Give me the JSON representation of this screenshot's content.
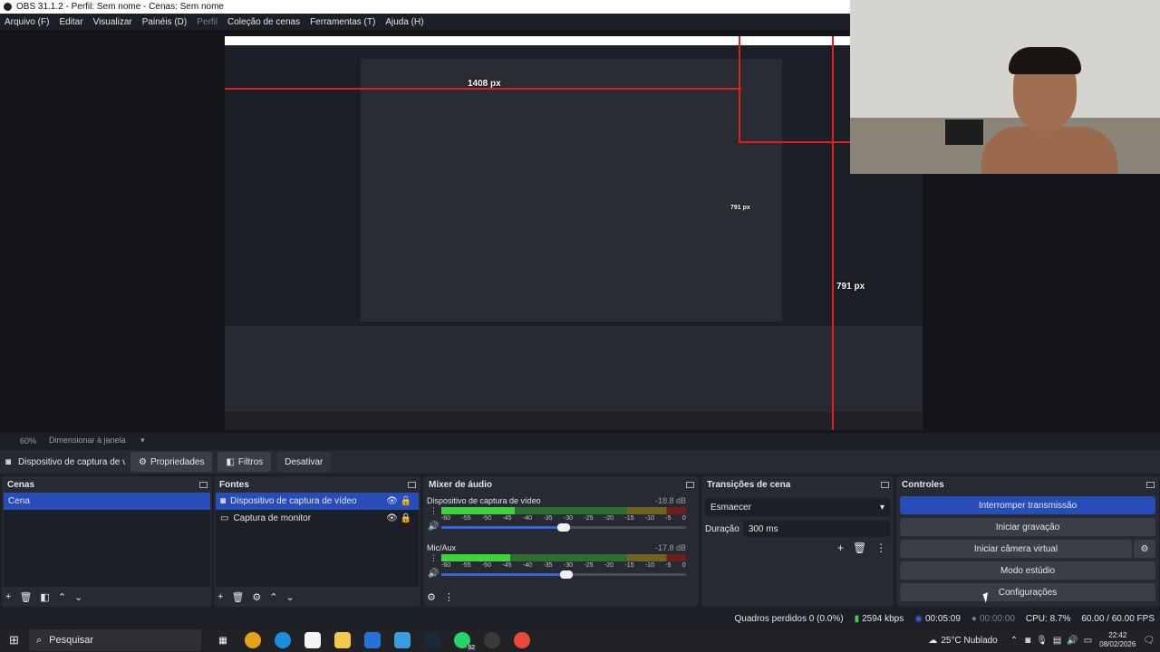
{
  "window": {
    "title": "OBS 31.1.2 - Perfil: Sem nome - Cenas: Sem nome"
  },
  "menu": [
    {
      "label": "Arquivo (F)",
      "dim": false
    },
    {
      "label": "Editar",
      "dim": false
    },
    {
      "label": "Visualizar",
      "dim": false
    },
    {
      "label": "Painéis (D)",
      "dim": false
    },
    {
      "label": "Perfil",
      "dim": true
    },
    {
      "label": "Coleção de cenas",
      "dim": false
    },
    {
      "label": "Ferramentas (T)",
      "dim": false
    },
    {
      "label": "Ajuda (H)",
      "dim": false
    }
  ],
  "preview": {
    "width_label": "1408 px",
    "height_label_top": "791 px",
    "height_label": "791 px",
    "zoom": "60%",
    "resize_label": "Dimensionar à janela"
  },
  "source_toolbar": {
    "source_name": "Dispositivo de captura de v",
    "properties": "Propriedades",
    "filters": "Filtros",
    "deactivate": "Desativar"
  },
  "scenes": {
    "title": "Cenas",
    "items": [
      "Cena"
    ]
  },
  "sources": {
    "title": "Fontes",
    "items": [
      {
        "label": "Dispositivo de captura de vídeo"
      },
      {
        "label": "Captura de monitor"
      }
    ]
  },
  "mixer": {
    "title": "Mixer de áudio",
    "scale": [
      "-60",
      "-55",
      "-50",
      "-45",
      "-40",
      "-35",
      "-30",
      "-25",
      "-20",
      "-15",
      "-10",
      "-5",
      "0"
    ],
    "channels": [
      {
        "name": "Dispositivo de captura de vídeo",
        "db": "-18.8 dB",
        "level": 0.3,
        "volume": 0.5
      },
      {
        "name": "Mic/Aux",
        "db": "-17.8 dB",
        "level": 0.28,
        "volume": 0.51
      }
    ]
  },
  "transitions": {
    "title": "Transições de cena",
    "selected": "Esmaecer",
    "duration_label": "Duração",
    "duration_value": "300 ms"
  },
  "controls": {
    "title": "Controles",
    "stop_stream": "Interromper transmissão",
    "start_recording": "Iniciar gravação",
    "start_virtual_cam": "Iniciar câmera virtual",
    "studio_mode": "Modo estúdio",
    "settings": "Configurações"
  },
  "status": {
    "dropped_frames": "Quadros perdidos 0 (0.0%)",
    "bitrate": "2594 kbps",
    "stream_time": "00:05:09",
    "rec_time": "00:00:00",
    "cpu": "CPU: 8.7%",
    "fps": "60.00 / 60.00 FPS"
  },
  "taskbar": {
    "search_placeholder": "Pesquisar",
    "whatsapp_badge": "92",
    "weather": "25°C  Nublado",
    "time": "22:42",
    "date": "08/02/2026"
  },
  "colors": {
    "accent": "#284cb8",
    "panel": "#272a33",
    "background": "#1d1f26",
    "guide": "#e02020"
  }
}
